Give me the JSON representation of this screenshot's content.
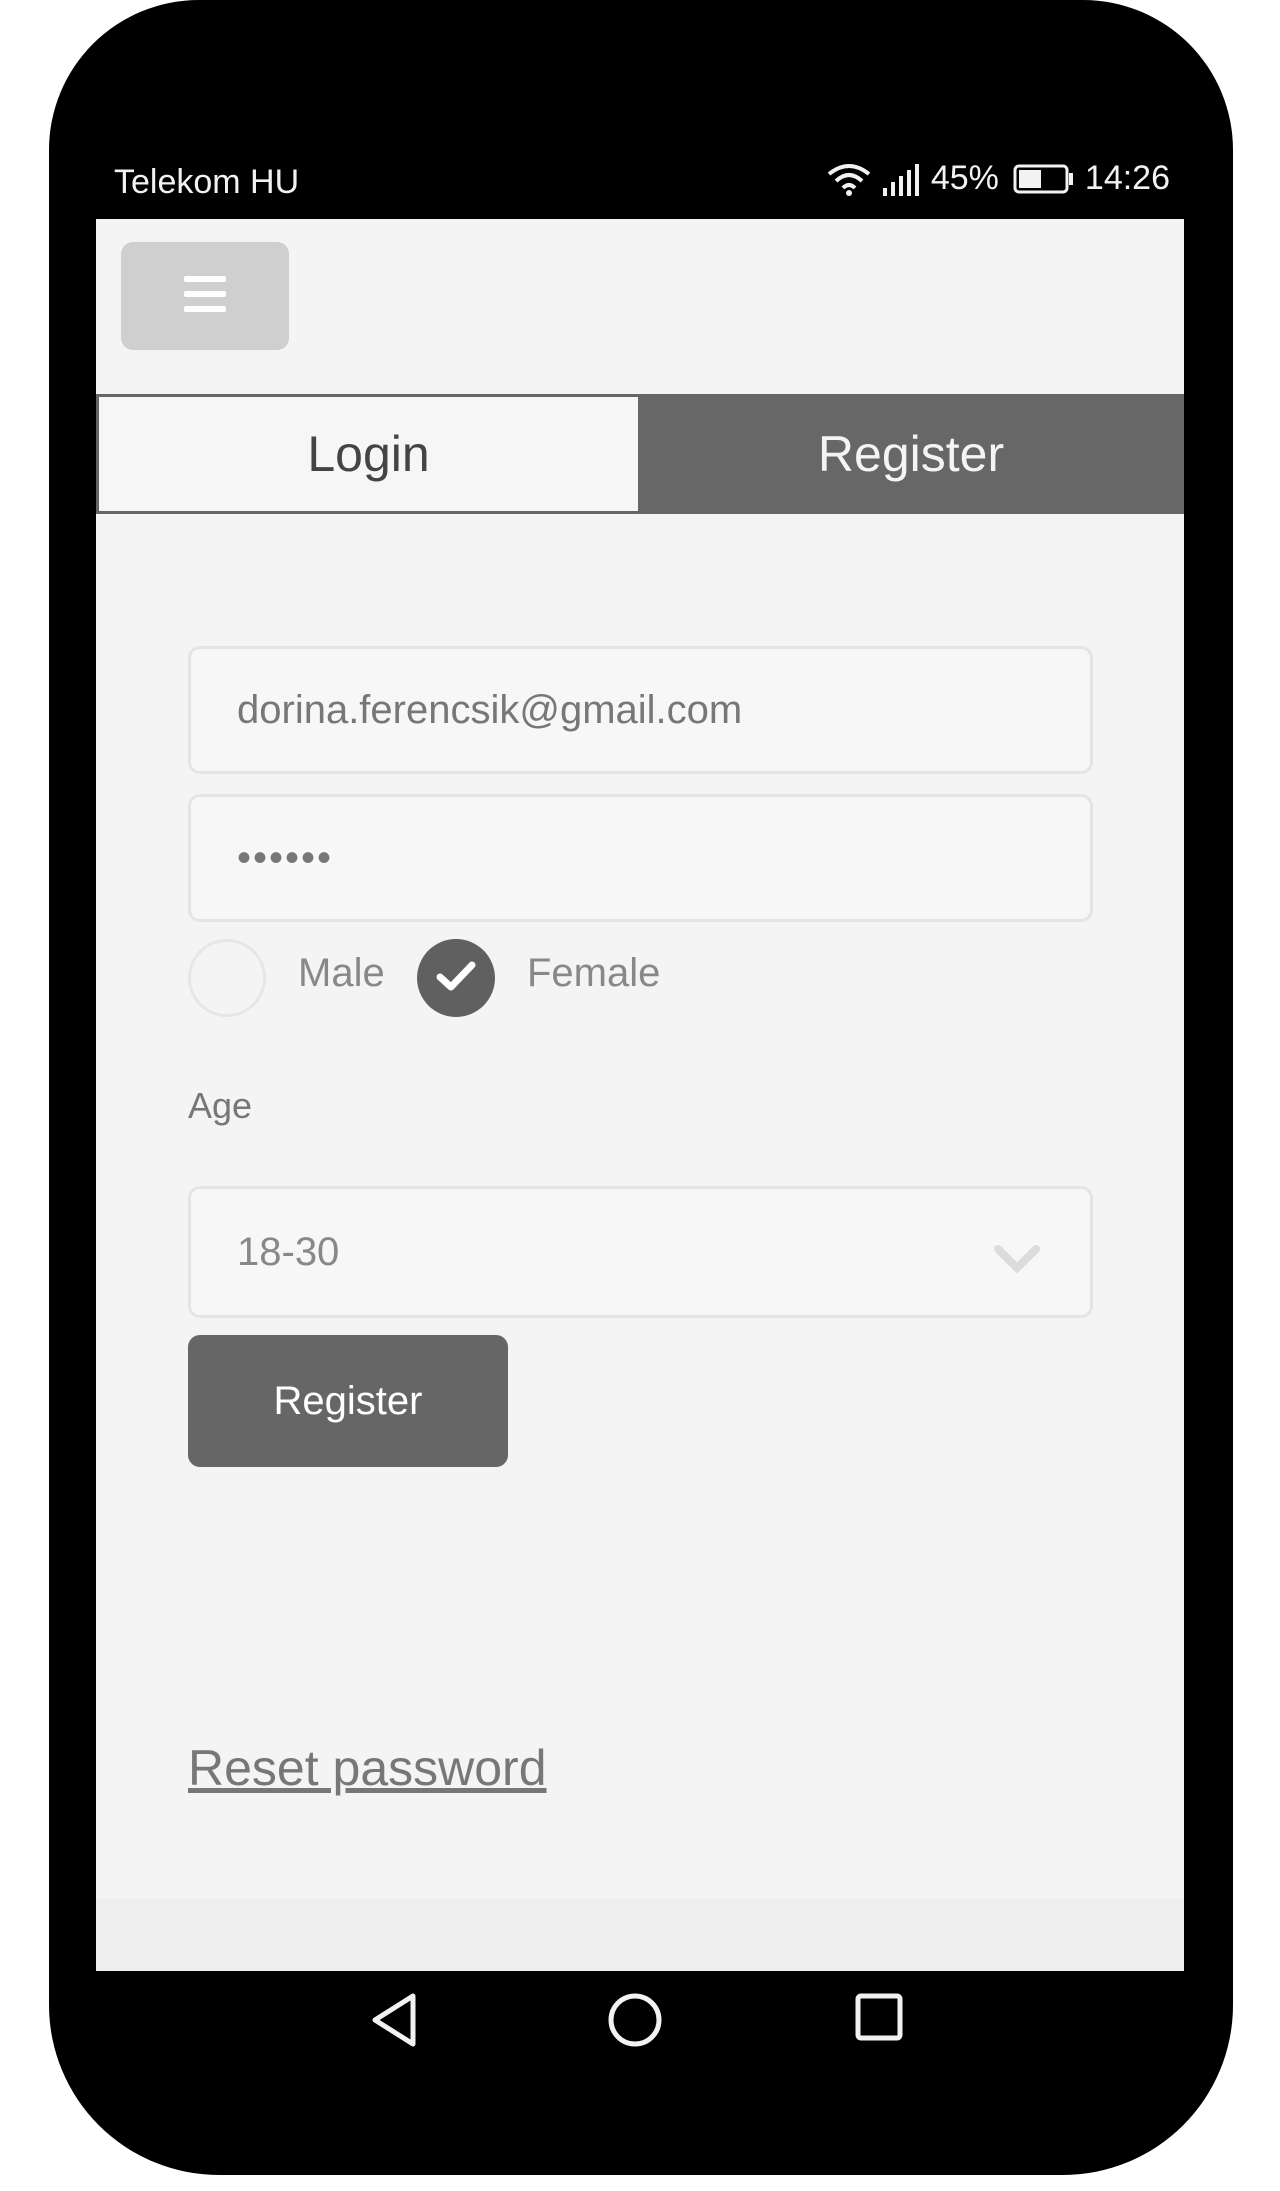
{
  "status_bar": {
    "carrier": "Telekom HU",
    "battery_percent": "45%",
    "time": "14:26",
    "icons": [
      "wifi-icon",
      "signal-icon",
      "battery-icon"
    ]
  },
  "header": {
    "menu_icon": "hamburger-menu-icon"
  },
  "tabs": [
    {
      "label": "Login",
      "active": false
    },
    {
      "label": "Register",
      "active": true
    }
  ],
  "form": {
    "email_value": "dorina.ferencsik@gmail.com",
    "password_value": "••••••",
    "gender": {
      "options": [
        {
          "label": "Male",
          "checked": false
        },
        {
          "label": "Female",
          "checked": true
        }
      ]
    },
    "age_label": "Age",
    "age_selected": "18-30",
    "submit_label": "Register"
  },
  "reset_password_label": "Reset password",
  "navigation_bar": {
    "icons": [
      "back-icon",
      "home-icon",
      "recents-icon"
    ]
  },
  "colors": {
    "active_tab": "#676767",
    "screen_bg": "#f4f4f4",
    "phone_frame": "#000000"
  }
}
